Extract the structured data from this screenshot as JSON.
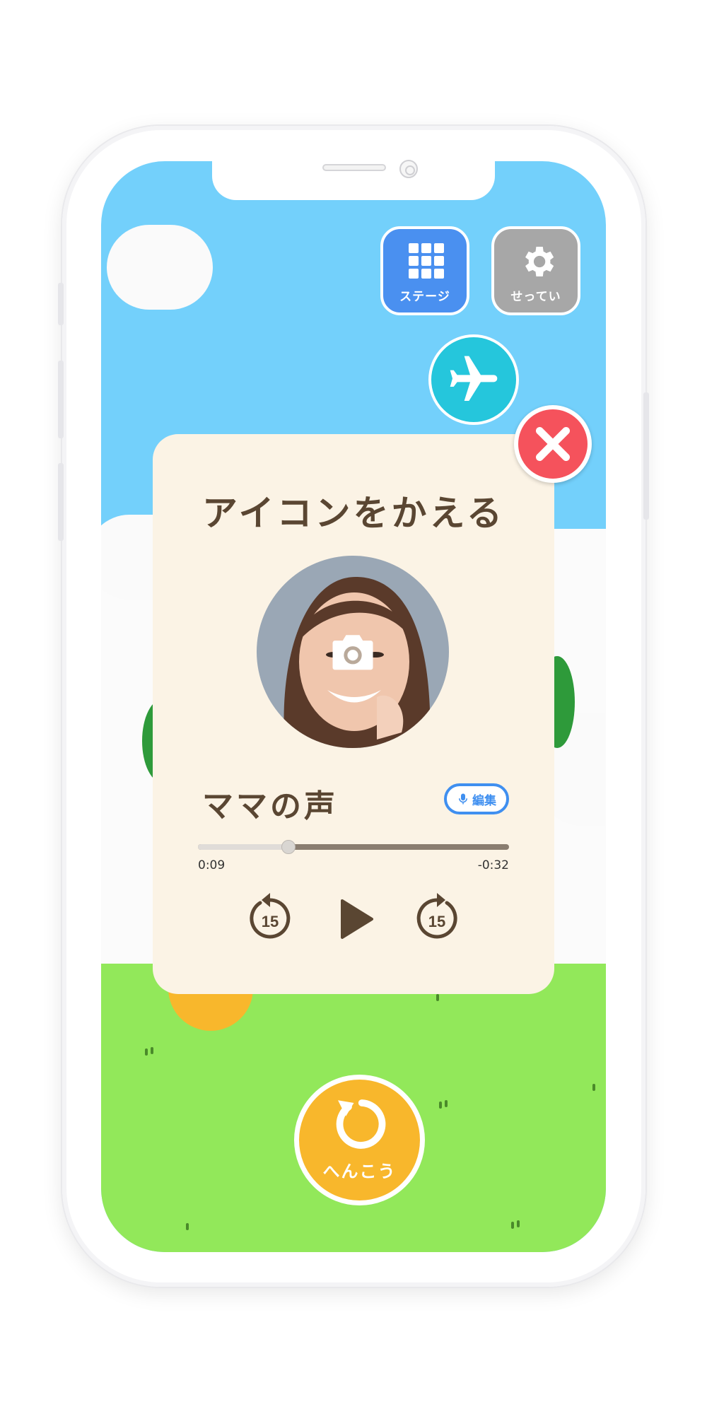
{
  "buttons": {
    "stage_label": "ステージ",
    "settings_label": "せってい",
    "change_label": "へんこう"
  },
  "modal": {
    "title": "アイコンをかえる",
    "voice_title": "ママの声",
    "edit_label": "編集",
    "player": {
      "elapsed": "0:09",
      "remaining": "-0:32",
      "progress": 0.29,
      "skip_back_seconds": "15",
      "skip_forward_seconds": "15"
    }
  },
  "colors": {
    "sky": "#73d0fb",
    "grass": "#92e85a",
    "stage_button": "#4a90f0",
    "settings_button": "#a7a7a7",
    "plane_button": "#25c6dc",
    "close_button": "#f5525c",
    "change_button": "#f8b72c",
    "modal_background": "#fbf3e5",
    "title_text": "#5a4632",
    "accent_blue": "#3f8ff0"
  },
  "icons": [
    "grid-icon",
    "gear-icon",
    "airplane-icon",
    "close-icon",
    "camera-icon",
    "microphone-icon",
    "skip-back-icon",
    "play-icon",
    "skip-forward-icon",
    "refresh-icon"
  ]
}
